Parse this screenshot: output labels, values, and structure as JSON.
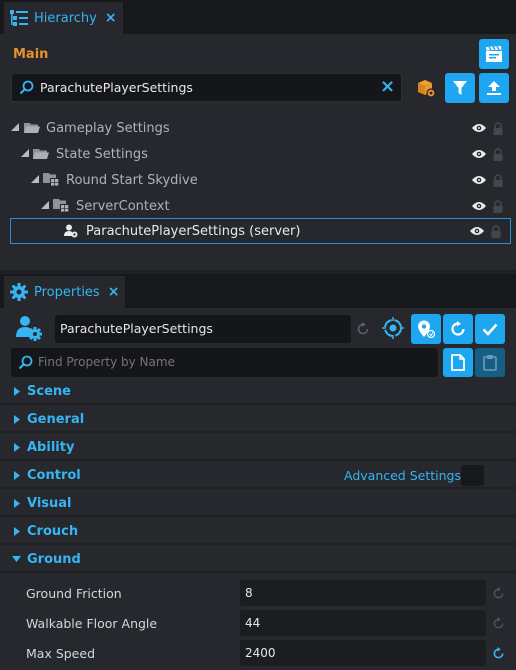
{
  "hierarchy": {
    "tab_label": "Hierarchy",
    "tab_close": "×",
    "scope_label": "Main",
    "search_value": "ParachutePlayerSettings",
    "search_clear": "×",
    "tree": [
      {
        "label": "Gameplay Settings",
        "type": "folder"
      },
      {
        "label": "State Settings",
        "type": "folder"
      },
      {
        "label": "Round Start Skydive",
        "type": "group"
      },
      {
        "label": "ServerContext",
        "type": "group"
      },
      {
        "label": "ParachutePlayerSettings (server)",
        "type": "settings",
        "selected": true
      }
    ]
  },
  "properties": {
    "tab_label": "Properties",
    "tab_close": "×",
    "object_name": "ParachutePlayerSettings",
    "find_placeholder": "Find Property by Name",
    "sections": [
      {
        "label": "Scene",
        "expanded": false
      },
      {
        "label": "General",
        "expanded": false
      },
      {
        "label": "Ability",
        "expanded": false
      },
      {
        "label": "Control",
        "expanded": false
      },
      {
        "label": "Visual",
        "expanded": false
      },
      {
        "label": "Crouch",
        "expanded": false
      },
      {
        "label": "Ground",
        "expanded": true
      }
    ],
    "advanced_settings_label": "Advanced Settings",
    "ground_props": [
      {
        "label": "Ground Friction",
        "value": "8",
        "modified": false
      },
      {
        "label": "Walkable Floor Angle",
        "value": "44",
        "modified": false
      },
      {
        "label": "Max Speed",
        "value": "2400",
        "modified": true
      }
    ]
  },
  "colors": {
    "accent": "#35b5f3",
    "button_blue": "#1ea7f0",
    "scope_orange": "#e8922b",
    "panel_bg": "#26282d"
  }
}
